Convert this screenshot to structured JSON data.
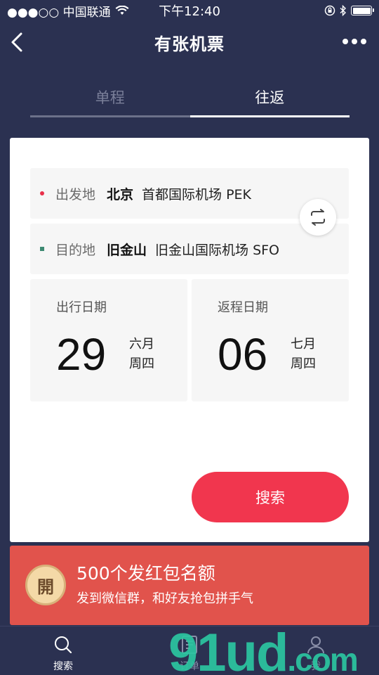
{
  "status_bar": {
    "carrier": "●●●○○ 中国联通",
    "time": "下午12:40"
  },
  "nav": {
    "title": "有张机票"
  },
  "tabs": [
    {
      "label": "单程",
      "active": false
    },
    {
      "label": "往返",
      "active": true
    }
  ],
  "route": {
    "from": {
      "label": "出发地",
      "city": "北京",
      "airport": "首都国际机场 PEK"
    },
    "to": {
      "label": "目的地",
      "city": "旧金山",
      "airport": "旧金山国际机场 SFO"
    }
  },
  "dates": {
    "depart": {
      "label": "出行日期",
      "day": "29",
      "month": "六月",
      "weekday": "周四"
    },
    "return": {
      "label": "返程日期",
      "day": "06",
      "month": "七月",
      "weekday": "周四"
    }
  },
  "search_button": "搜索",
  "banner": {
    "badge": "開",
    "title": "500个发红包名额",
    "subtitle": "发到微信群，和好友抢包拼手气"
  },
  "tabbar": [
    {
      "label": "搜索",
      "icon": "search-icon"
    },
    {
      "label": "订单",
      "icon": "order-icon"
    },
    {
      "label": "我",
      "icon": "user-icon"
    }
  ],
  "watermark": {
    "main": "91ud",
    "suffix": ".com"
  },
  "colors": {
    "background": "#2b3151",
    "accent_red": "#f1364e",
    "banner_red": "#e1534c",
    "from_dot": "#e8304a",
    "to_dot": "#3d8a72"
  }
}
